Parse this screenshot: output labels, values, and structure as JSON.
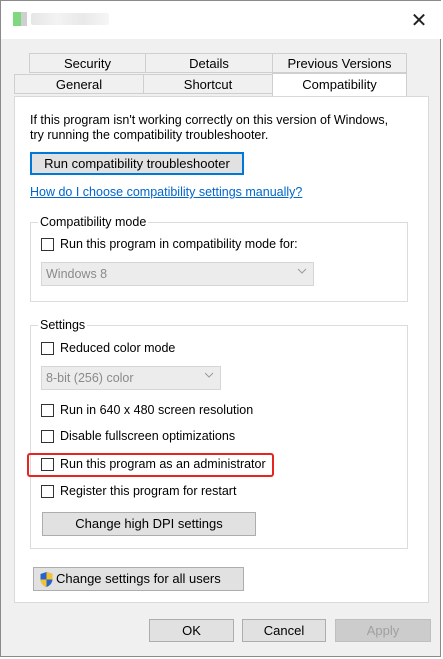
{
  "window": {
    "close_glyph": "✕"
  },
  "tabs": {
    "row1": [
      "Security",
      "Details",
      "Previous Versions"
    ],
    "row2": [
      "General",
      "Shortcut",
      "Compatibility"
    ],
    "active": "Compatibility"
  },
  "intro": {
    "line1": "If this program isn't working correctly on this version of Windows,",
    "line2": "try running the compatibility troubleshooter."
  },
  "troubleshooter_button": "Run compatibility troubleshooter",
  "help_link": "How do I choose compatibility settings manually?",
  "compat_mode": {
    "legend": "Compatibility mode",
    "checkbox_label": "Run this program in compatibility mode for:",
    "checked": false,
    "dropdown_value": "Windows 8"
  },
  "settings": {
    "legend": "Settings",
    "reduced_color": "Reduced color mode",
    "color_dropdown": "8-bit (256) color",
    "res_640": "Run in 640 x 480 screen resolution",
    "disable_fullscreen": "Disable fullscreen optimizations",
    "run_as_admin": "Run this program as an administrator",
    "register_restart": "Register this program for restart",
    "dpi_button": "Change high DPI settings"
  },
  "all_users_button": "Change settings for all users",
  "footer": {
    "ok": "OK",
    "cancel": "Cancel",
    "apply": "Apply"
  },
  "colors": {
    "highlight": "#e52520",
    "link": "#0066cc",
    "focus": "#0078d7"
  }
}
